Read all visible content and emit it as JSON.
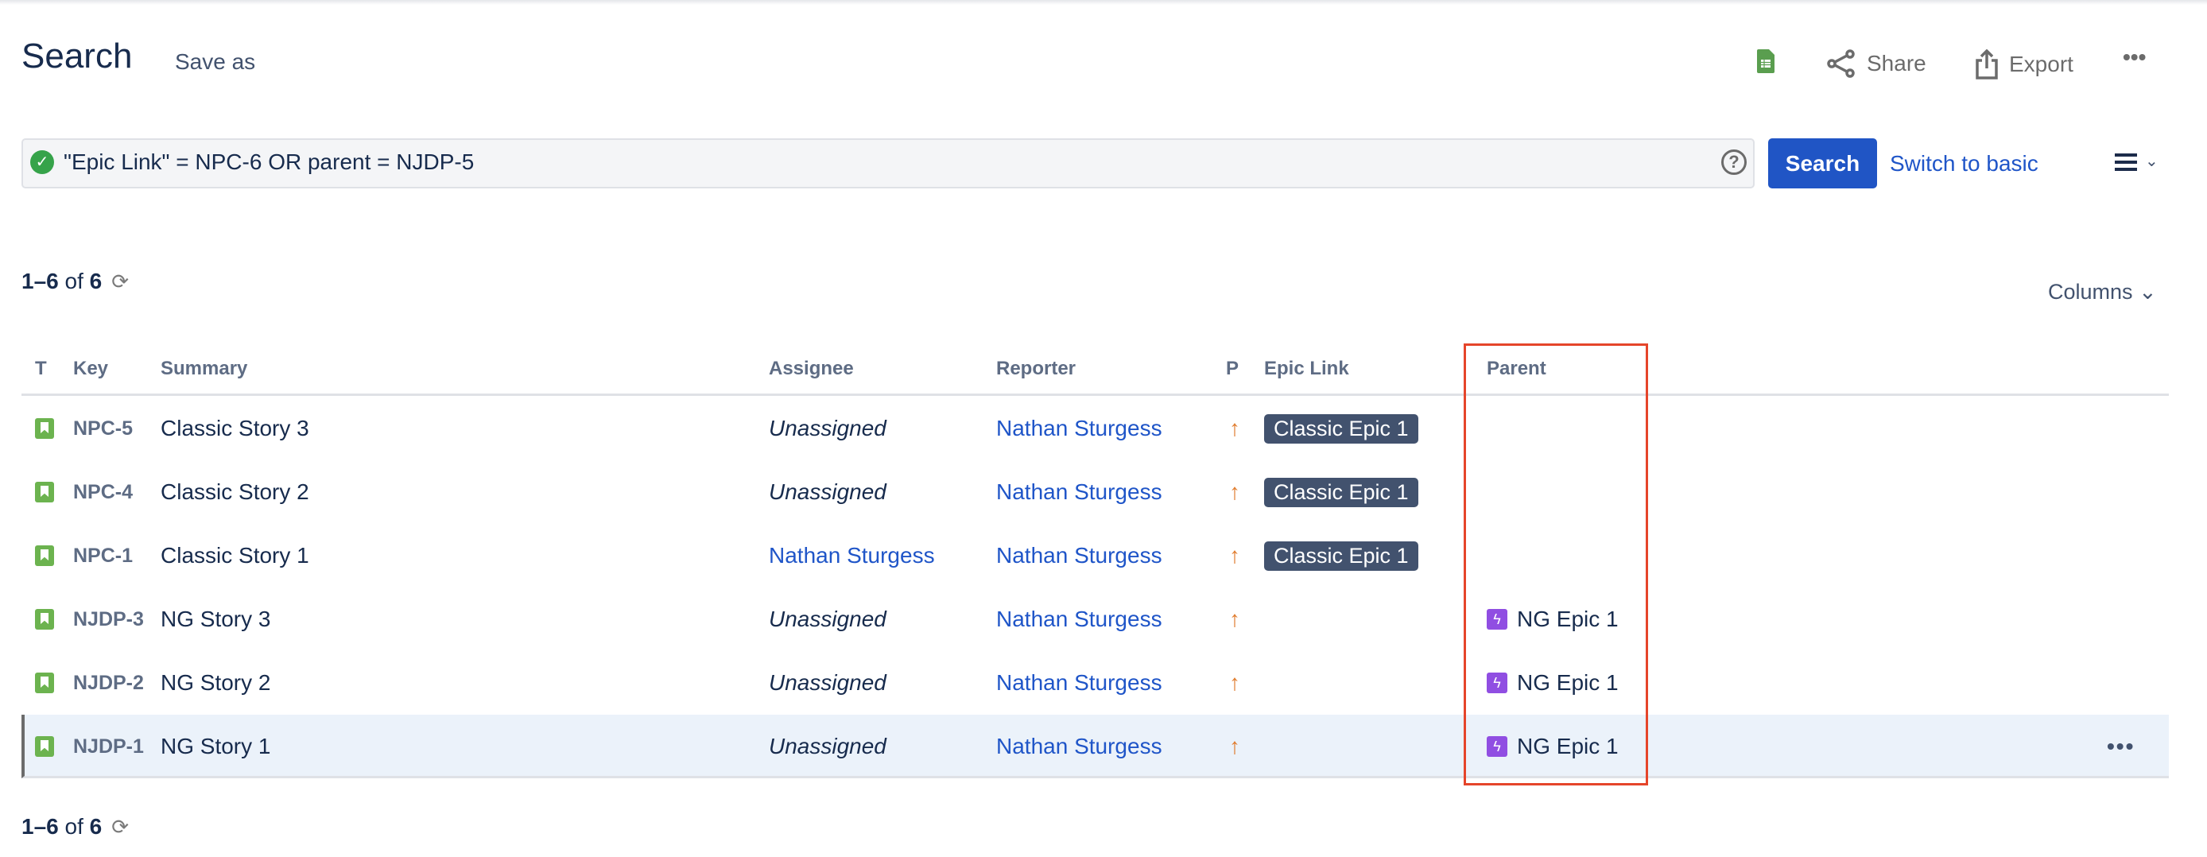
{
  "header": {
    "title": "Search",
    "save_as": "Save as",
    "share": "Share",
    "export": "Export",
    "more": "•••"
  },
  "query": {
    "value": "\"Epic Link\" = NPC-6 OR parent = NJDP-5",
    "help": "?",
    "search_button": "Search",
    "switch_basic": "Switch to basic"
  },
  "count": {
    "range": "1–6",
    "of": "of",
    "total": "6"
  },
  "columns_button": "Columns",
  "table": {
    "headers": {
      "t": "T",
      "key": "Key",
      "summary": "Summary",
      "assignee": "Assignee",
      "reporter": "Reporter",
      "p": "P",
      "epic": "Epic Link",
      "parent": "Parent"
    },
    "rows": [
      {
        "key": "NPC-5",
        "summary": "Classic Story 3",
        "assignee": "Unassigned",
        "reporter": "Nathan Sturgess",
        "epic": "Classic Epic 1",
        "parent": ""
      },
      {
        "key": "NPC-4",
        "summary": "Classic Story 2",
        "assignee": "Unassigned",
        "reporter": "Nathan Sturgess",
        "epic": "Classic Epic 1",
        "parent": ""
      },
      {
        "key": "NPC-1",
        "summary": "Classic Story 1",
        "assignee": "Nathan Sturgess",
        "reporter": "Nathan Sturgess",
        "epic": "Classic Epic 1",
        "parent": ""
      },
      {
        "key": "NJDP-3",
        "summary": "NG Story 3",
        "assignee": "Unassigned",
        "reporter": "Nathan Sturgess",
        "epic": "",
        "parent": "NG Epic 1"
      },
      {
        "key": "NJDP-2",
        "summary": "NG Story 2",
        "assignee": "Unassigned",
        "reporter": "Nathan Sturgess",
        "epic": "",
        "parent": "NG Epic 1"
      },
      {
        "key": "NJDP-1",
        "summary": "NG Story 1",
        "assignee": "Unassigned",
        "reporter": "Nathan Sturgess",
        "epic": "",
        "parent": "NG Epic 1",
        "selected": true
      }
    ]
  },
  "colors": {
    "accent": "#2055c5",
    "story": "#6cb34f",
    "epic": "#904ee2",
    "priority": "#e07b2c",
    "highlight": "#e5452a"
  }
}
